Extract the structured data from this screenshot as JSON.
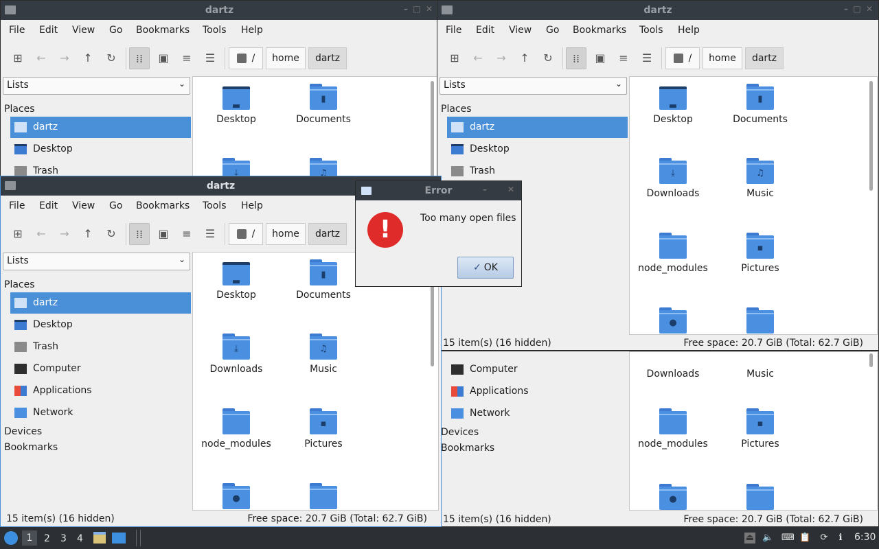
{
  "menu": [
    "File",
    "Edit",
    "View",
    "Go",
    "Bookmarks",
    "Tools",
    "Help"
  ],
  "path": {
    "root": "/",
    "home": "home",
    "user": "dartz"
  },
  "combo": "Lists",
  "headers": {
    "places": "Places",
    "devices": "Devices",
    "bookmarks": "Bookmarks"
  },
  "places": [
    "dartz",
    "Desktop",
    "Trash",
    "Computer",
    "Applications",
    "Network"
  ],
  "files": [
    "Desktop",
    "Documents",
    "Downloads",
    "Music",
    "node_modules",
    "Pictures"
  ],
  "status": {
    "items": "15 item(s) (16 hidden)",
    "space": "Free space: 20.7 GiB (Total: 62.7 GiB)"
  },
  "windows": [
    {
      "title": "dartz"
    },
    {
      "title": "dartz"
    },
    {
      "title": "dartz"
    }
  ],
  "dialog": {
    "title": "Error",
    "message": "Too many open files",
    "ok": "OK"
  },
  "taskbar": {
    "workspaces": [
      "1",
      "2",
      "3",
      "4"
    ],
    "active_workspace": "1",
    "clock": "6:30"
  },
  "colors": {
    "accent": "#4a90d9",
    "titlebar": "#353b42",
    "error": "#e02b2b",
    "folder": "#4a8fe0"
  }
}
